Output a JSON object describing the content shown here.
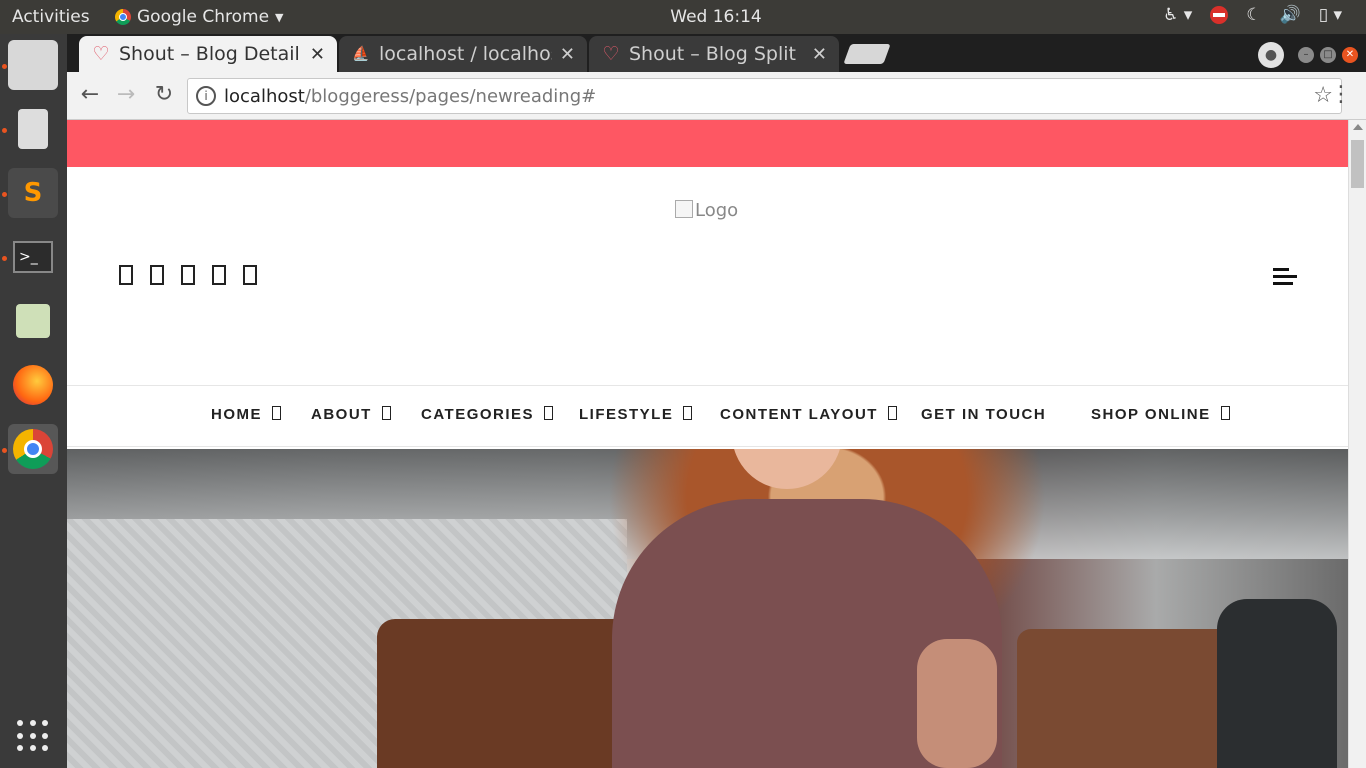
{
  "os": {
    "activities": "Activities",
    "app_menu": "Google Chrome",
    "clock": "Wed 16:14"
  },
  "browser": {
    "tabs": [
      {
        "title": "Shout – Blog Detail",
        "icon": "heart-icon",
        "active": true
      },
      {
        "title": "localhost / localhost",
        "icon": "phpmyadmin-icon",
        "active": false
      },
      {
        "title": "Shout – Blog Split | S",
        "icon": "heart-icon",
        "active": false
      }
    ],
    "url_host": "localhost",
    "url_path": "/bloggeress/pages/newreading#"
  },
  "site": {
    "logo_alt": "Logo",
    "nav": [
      {
        "label": "HOME",
        "has_dropdown": true
      },
      {
        "label": "ABOUT",
        "has_dropdown": true
      },
      {
        "label": "CATEGORIES",
        "has_dropdown": true
      },
      {
        "label": "LIFESTYLE",
        "has_dropdown": true
      },
      {
        "label": "CONTENT LAYOUT",
        "has_dropdown": true
      },
      {
        "label": "GET IN TOUCH",
        "has_dropdown": false
      },
      {
        "label": "SHOP ONLINE",
        "has_dropdown": true
      }
    ],
    "colors": {
      "accent_bar": "#fe5763"
    }
  }
}
